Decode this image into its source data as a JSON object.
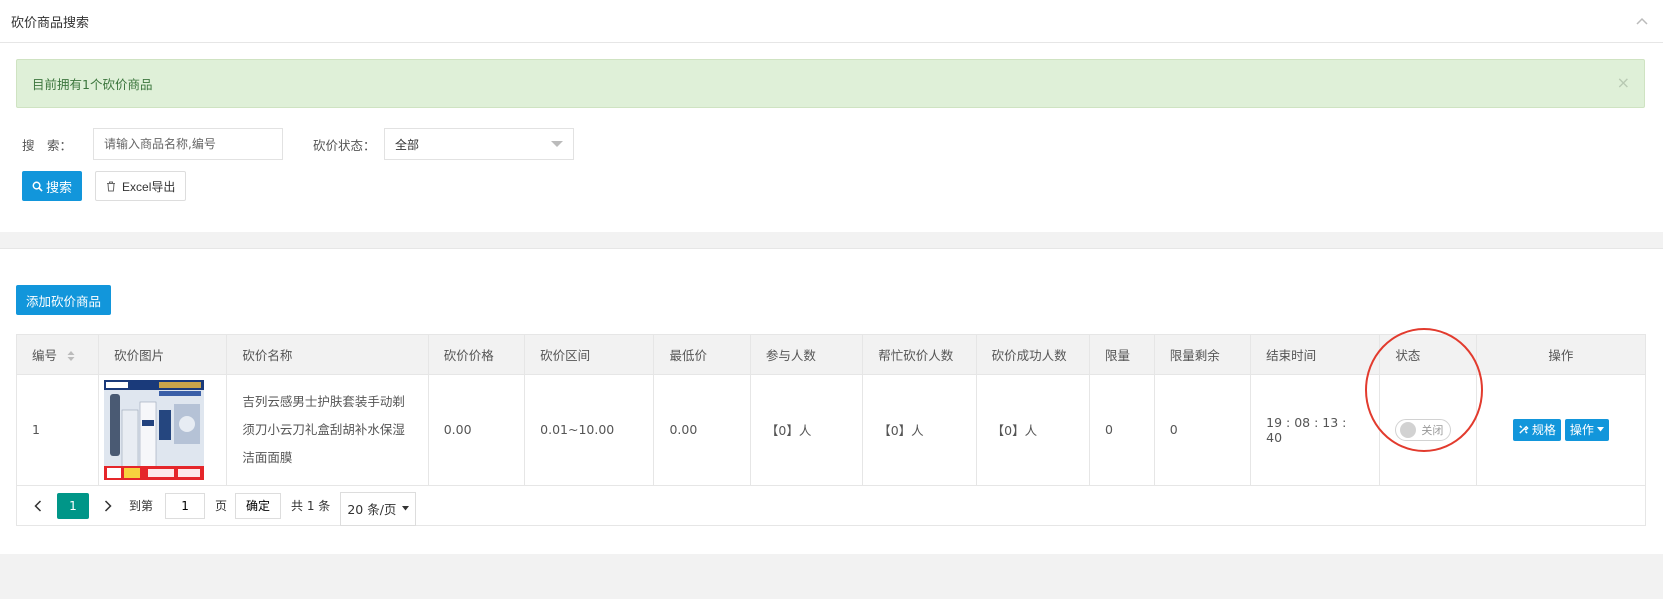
{
  "header": {
    "title": "砍价商品搜索"
  },
  "alert": {
    "text": "目前拥有1个砍价商品",
    "close": "×"
  },
  "search": {
    "keyword_label": "搜　索：",
    "keyword_placeholder": "请输入商品名称,编号",
    "status_label": "砍价状态：",
    "status_value": "全部",
    "search_button": "搜索",
    "export_button": "Excel导出"
  },
  "main": {
    "add_button": "添加砍价商品"
  },
  "table": {
    "columns": [
      "编号",
      "砍价图片",
      "砍价名称",
      "砍价价格",
      "砍价区间",
      "最低价",
      "参与人数",
      "帮忙砍价人数",
      "砍价成功人数",
      "限量",
      "限量剩余",
      "结束时间",
      "状态",
      "操作"
    ],
    "rows": [
      {
        "id": "1",
        "image_alt": "吉列云感男士护肤套装",
        "name": "吉列云感男士护肤套装手动剃须刀小云刀礼盒刮胡补水保湿洁面面膜",
        "price": "0.00",
        "range": "0.01~10.00",
        "min_price": "0.00",
        "participants": "【0】人",
        "helpers": "【0】人",
        "successes": "【0】人",
        "limit": "0",
        "remaining": "0",
        "end_time": "19 : 08 : 13 : 40",
        "status_text": "关闭",
        "action_spec": "规格",
        "action_more": "操作"
      }
    ]
  },
  "pager": {
    "current": "1",
    "goto_label": "到第",
    "goto_value": "1",
    "page_unit": "页",
    "confirm": "确定",
    "total": "共 1 条",
    "page_size": "20 条/页"
  },
  "colors": {
    "primary": "#1296db",
    "pager_active": "#009688",
    "alert_bg": "#dff0d8",
    "highlight_circle": "#e23b2e"
  }
}
